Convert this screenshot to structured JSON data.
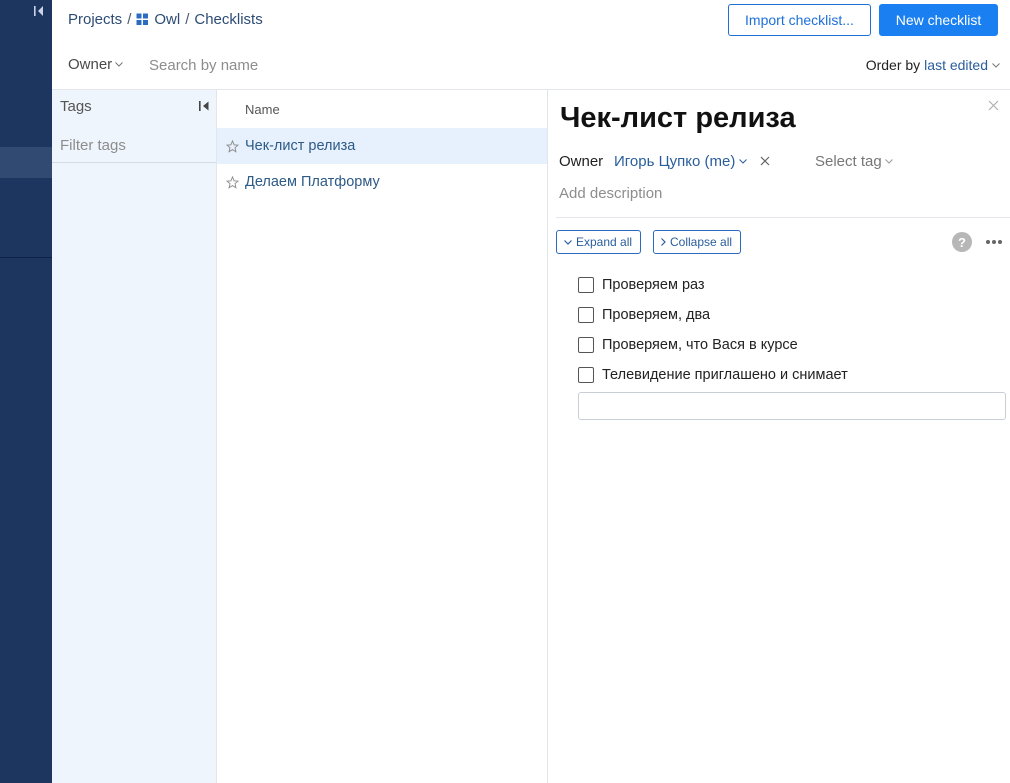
{
  "breadcrumb": {
    "projects": "Projects",
    "separator": "/",
    "project": "Owl",
    "section": "Checklists",
    "project_icon": "grid-icon"
  },
  "header": {
    "import_label": "Import checklist...",
    "new_label": "New checklist",
    "owner_filter_label": "Owner",
    "search_placeholder": "Search by name",
    "order_prefix": "Order by",
    "order_value": "last edited"
  },
  "tags": {
    "title": "Tags",
    "filter_placeholder": "Filter tags"
  },
  "list": {
    "column_name": "Name",
    "rows": [
      {
        "name": "Чек-лист релиза",
        "active": true
      },
      {
        "name": "Делаем Платформу",
        "active": false
      }
    ]
  },
  "detail": {
    "title": "Чек-лист релиза",
    "owner_label": "Owner",
    "owner_value": "Игорь Цупко (me)",
    "select_tag": "Select tag",
    "description_placeholder": "Add description",
    "expand_all": "Expand all",
    "collapse_all": "Collapse all",
    "help": "?",
    "items": [
      {
        "text": "Проверяем раз",
        "checked": false
      },
      {
        "text": "Проверяем, два",
        "checked": false
      },
      {
        "text": "Проверяем, что Вася в курсе",
        "checked": false
      },
      {
        "text": "Телевидение приглашено и снимает",
        "checked": false
      }
    ],
    "new_item_value": ""
  },
  "colors": {
    "nav_bg": "#1c3660",
    "primary": "#1a7ff0",
    "link": "#2a5d9c",
    "tags_bg": "#eef5fc",
    "active_row": "#e6f1fd"
  }
}
